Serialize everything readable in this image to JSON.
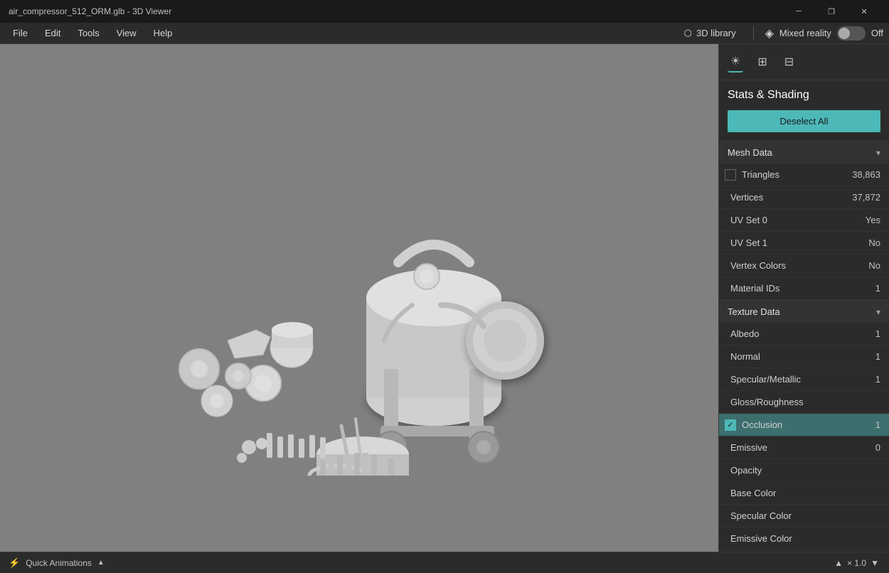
{
  "titlebar": {
    "title": "air_compressor_512_ORM.glb - 3D Viewer",
    "minimize": "─",
    "restore": "❐",
    "close": "✕"
  },
  "menubar": {
    "items": [
      "File",
      "Edit",
      "Tools",
      "View",
      "Help"
    ],
    "library_btn": "3D library",
    "mixed_reality_label": "Mixed reality",
    "mixed_reality_state": "Off"
  },
  "panel": {
    "title": "Stats & Shading",
    "deselect_all": "Deselect All",
    "toolbar_icons": [
      "sun",
      "grid",
      "apps"
    ],
    "mesh_data": {
      "label": "Mesh Data",
      "rows": [
        {
          "label": "Triangles",
          "value": "38,863",
          "has_checkbox": true,
          "checked": false,
          "selected": false
        },
        {
          "label": "Vertices",
          "value": "37,872",
          "has_checkbox": false,
          "selected": false
        },
        {
          "label": "UV Set 0",
          "value": "Yes",
          "has_checkbox": false,
          "selected": false
        },
        {
          "label": "UV Set 1",
          "value": "No",
          "has_checkbox": false,
          "selected": false
        },
        {
          "label": "Vertex Colors",
          "value": "No",
          "has_checkbox": false,
          "selected": false
        },
        {
          "label": "Material IDs",
          "value": "1",
          "has_checkbox": false,
          "selected": false
        }
      ]
    },
    "texture_data": {
      "label": "Texture Data",
      "rows": [
        {
          "label": "Albedo",
          "value": "1",
          "has_checkbox": false,
          "selected": false
        },
        {
          "label": "Normal",
          "value": "1",
          "has_checkbox": false,
          "selected": false
        },
        {
          "label": "Specular/Metallic",
          "value": "1",
          "has_checkbox": false,
          "selected": false
        },
        {
          "label": "Gloss/Roughness",
          "value": "",
          "has_checkbox": false,
          "selected": false
        },
        {
          "label": "Occlusion",
          "value": "1",
          "has_checkbox": true,
          "checked": true,
          "selected": true
        },
        {
          "label": "Emissive",
          "value": "0",
          "has_checkbox": false,
          "selected": false
        },
        {
          "label": "Opacity",
          "value": "",
          "has_checkbox": false,
          "selected": false
        },
        {
          "label": "Base Color",
          "value": "",
          "has_checkbox": false,
          "selected": false
        },
        {
          "label": "Specular Color",
          "value": "",
          "has_checkbox": false,
          "selected": false
        },
        {
          "label": "Emissive Color",
          "value": "",
          "has_checkbox": false,
          "selected": false
        }
      ]
    }
  },
  "bottom_bar": {
    "animations_label": "Quick Animations",
    "zoom_label": "× 1.0"
  }
}
